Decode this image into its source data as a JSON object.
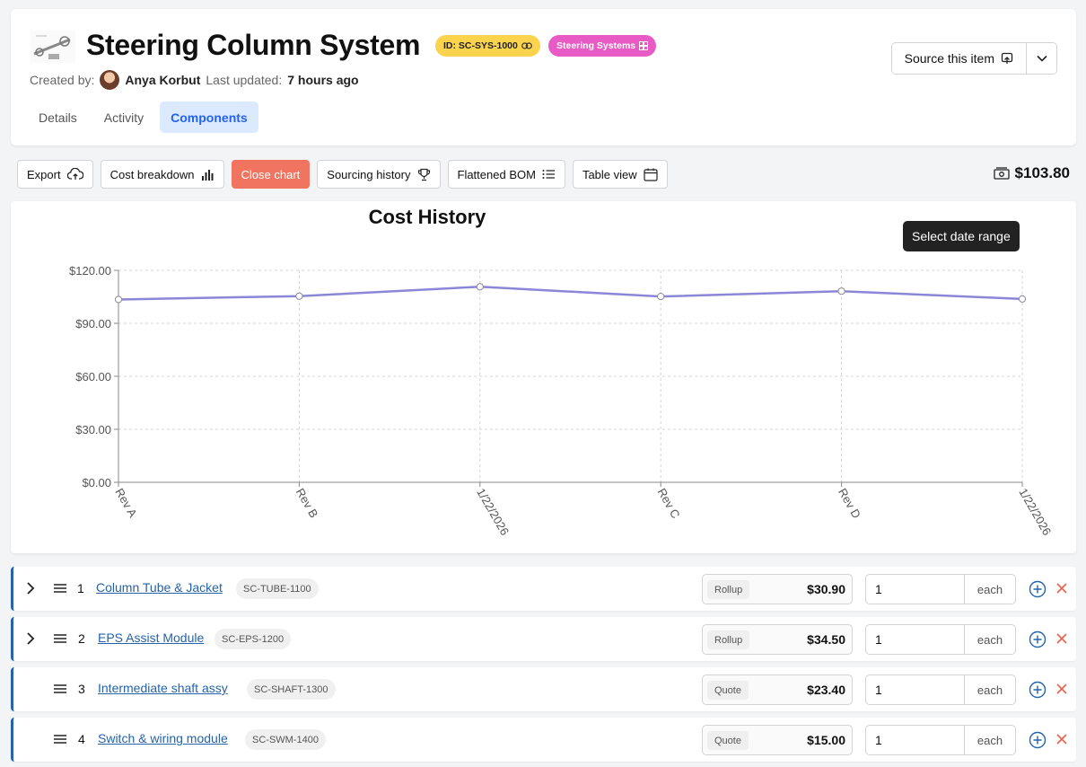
{
  "header": {
    "title": "Steering Column System",
    "id_badge": "ID: SC-SYS-1000",
    "category_badge": "Steering Systems",
    "created_by_label": "Created by:",
    "created_by": "Anya Korbut",
    "updated_label": "Last updated:",
    "updated_value": "7 hours ago",
    "tabs": [
      {
        "label": "Details",
        "active": false
      },
      {
        "label": "Activity",
        "active": false
      },
      {
        "label": "Components",
        "active": true
      }
    ],
    "source_button": "Source this item"
  },
  "toolbar": {
    "export": "Export",
    "cost_breakdown": "Cost breakdown",
    "close_chart": "Close chart",
    "sourcing_history": "Sourcing history",
    "flattened_bom": "Flattened BOM",
    "table_view": "Table view",
    "total": "$103.80"
  },
  "chart": {
    "date_range_button": "Select date range",
    "accent_color": "#8b86d6"
  },
  "chart_data": {
    "type": "line",
    "title": "Cost History",
    "x": [
      "Rev A",
      "Rev B",
      "1/22/2026",
      "Rev C",
      "Rev D",
      "1/22/2026"
    ],
    "series": [
      {
        "values": [
          103.5,
          105.4,
          110.7,
          105.2,
          108.2,
          103.8
        ]
      }
    ],
    "y_ticks": [
      "$0.00",
      "$30.00",
      "$60.00",
      "$90.00",
      "$120.00"
    ],
    "ylim": [
      0,
      120
    ],
    "grid": true
  },
  "components": [
    {
      "index": "1",
      "name": "Column Tube & Jacket",
      "code": "SC-TUBE-1100",
      "cost_type": "Rollup",
      "cost": "$30.90",
      "qty": "1",
      "unit": "each",
      "expandable": true
    },
    {
      "index": "2",
      "name": "EPS Assist Module",
      "code": "SC-EPS-1200",
      "cost_type": "Rollup",
      "cost": "$34.50",
      "qty": "1",
      "unit": "each",
      "expandable": true
    },
    {
      "index": "3",
      "name": "Intermediate shaft assy",
      "code": "SC-SHAFT-1300",
      "cost_type": "Quote",
      "cost": "$23.40",
      "qty": "1",
      "unit": "each",
      "expandable": false
    },
    {
      "index": "4",
      "name": "Switch & wiring module",
      "code": "SC-SWM-1400",
      "cost_type": "Quote",
      "cost": "$15.00",
      "qty": "1",
      "unit": "each",
      "expandable": false
    }
  ]
}
